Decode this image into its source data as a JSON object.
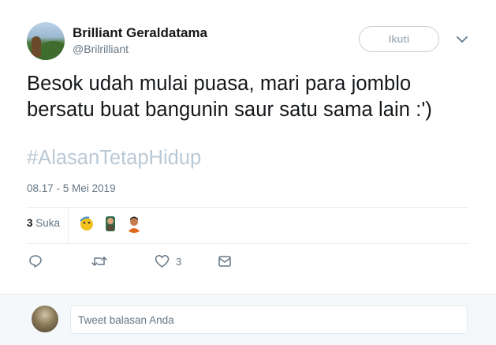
{
  "user": {
    "name": "Brilliant Geraldatama",
    "handle": "@Brilrilliant"
  },
  "follow_label": "Ikuti",
  "tweet": {
    "text_line1": "Besok udah mulai puasa, mari para jomblo",
    "text_line2": "bersatu buat bangunin saur satu sama lain :')",
    "hashtag": "#AlasanTetapHidup",
    "timestamp": "08.17 - 5 Mei 2019"
  },
  "stats": {
    "like_count": "3",
    "like_label": "Suka"
  },
  "actions": {
    "like_count": "3"
  },
  "reply": {
    "placeholder": "Tweet balasan Anda"
  },
  "colors": {
    "hashtag": "#b9c9d6",
    "secondary_text": "#657786",
    "reply_bar_bg": "#f5f8fa"
  },
  "icons": [
    "chevron-down-icon",
    "reply-icon",
    "retweet-icon",
    "heart-icon",
    "message-icon"
  ]
}
